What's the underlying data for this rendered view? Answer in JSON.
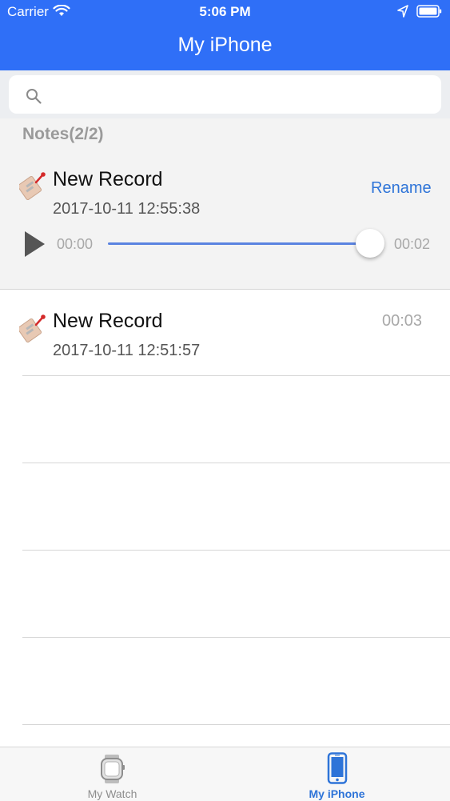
{
  "status_bar": {
    "carrier": "Carrier",
    "time": "5:06 PM",
    "icons": [
      "wifi-icon",
      "location-arrow-icon",
      "battery-icon"
    ]
  },
  "nav": {
    "title": "My iPhone"
  },
  "search": {
    "placeholder": "",
    "value": ""
  },
  "section": {
    "label": "Notes(2/2)"
  },
  "records": [
    {
      "title": "New Record",
      "date": "2017-10-11 12:55:38",
      "rename_label": "Rename",
      "expanded": true,
      "player": {
        "elapsed": "00:00",
        "total": "00:02",
        "progress": 1.0
      }
    },
    {
      "title": "New Record",
      "date": "2017-10-11 12:51:57",
      "duration": "00:03",
      "expanded": false
    }
  ],
  "tab_bar": {
    "tabs": [
      {
        "label": "My Watch",
        "icon": "watch-icon",
        "active": false
      },
      {
        "label": "My iPhone",
        "icon": "iphone-icon",
        "active": true
      }
    ]
  },
  "colors": {
    "accent": "#2f6ff7",
    "link": "#2e74d8",
    "tab_active": "#2e74d8",
    "tab_inactive": "#8e8e8e"
  }
}
